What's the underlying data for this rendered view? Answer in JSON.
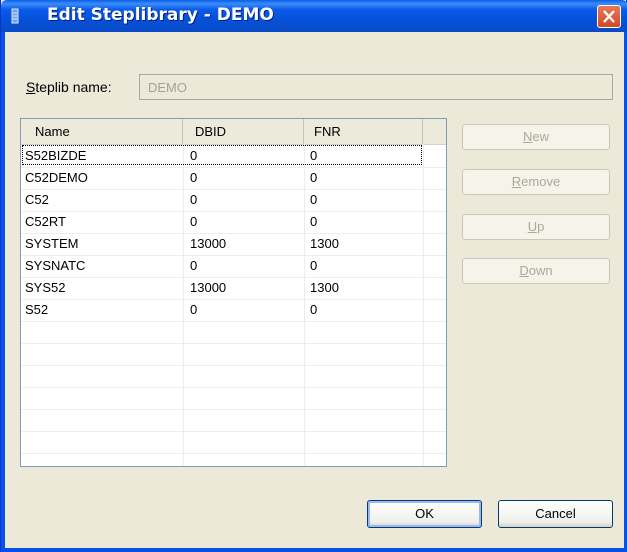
{
  "window": {
    "title": "Edit Steplibrary - DEMO"
  },
  "form": {
    "steplib_label_mnemonic": "S",
    "steplib_label_rest": "teplib name:",
    "steplib_value": "DEMO"
  },
  "table": {
    "columns": [
      "Name",
      "DBID",
      "FNR"
    ],
    "rows": [
      {
        "name": "S52BIZDE",
        "dbid": "0",
        "fnr": "0"
      },
      {
        "name": "C52DEMO",
        "dbid": "0",
        "fnr": "0"
      },
      {
        "name": "C52",
        "dbid": "0",
        "fnr": "0"
      },
      {
        "name": "C52RT",
        "dbid": "0",
        "fnr": "0"
      },
      {
        "name": "SYSTEM",
        "dbid": "13000",
        "fnr": "1300"
      },
      {
        "name": "SYSNATC",
        "dbid": "0",
        "fnr": "0"
      },
      {
        "name": "SYS52",
        "dbid": "13000",
        "fnr": "1300"
      },
      {
        "name": "S52",
        "dbid": "0",
        "fnr": "0"
      }
    ],
    "empty_rows": 6
  },
  "side_buttons": [
    {
      "mnemonic": "N",
      "rest": "ew",
      "pre": ""
    },
    {
      "mnemonic": "R",
      "rest": "emove",
      "pre": ""
    },
    {
      "mnemonic": "U",
      "rest": "p",
      "pre": ""
    },
    {
      "mnemonic": "D",
      "rest": "own",
      "pre": ""
    }
  ],
  "footer": {
    "ok_label": "OK",
    "cancel_label": "Cancel"
  },
  "colors": {
    "titlebar": "#0553e4",
    "close": "#d24a24",
    "dialog_bg": "#ece9d8",
    "disabled_text": "#aca899"
  },
  "icons": {
    "title": "window-icon",
    "close": "close-icon"
  }
}
